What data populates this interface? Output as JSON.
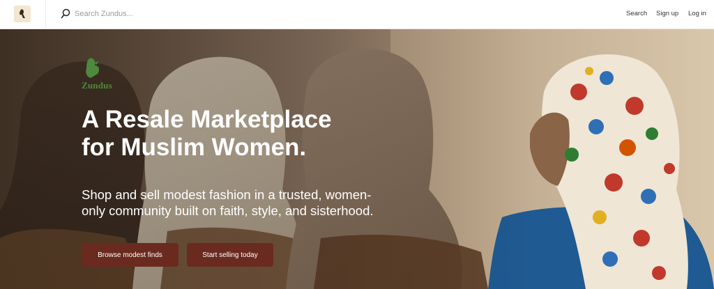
{
  "navbar": {
    "logo_icon": "bird-logo-icon",
    "search_placeholder": "Search Zundus...",
    "links": {
      "search": "Search",
      "signup": "Sign up",
      "login": "Log in"
    }
  },
  "hero": {
    "brand": "Zundus",
    "title_line1": "A Resale Marketplace",
    "title_line2": "for Muslim Women.",
    "subtitle_line1": "Shop and sell modest fashion in a trusted, women-",
    "subtitle_line2": "only community built on faith, style, and sisterhood.",
    "buttons": {
      "browse": "Browse modest finds",
      "sell": "Start selling today"
    }
  },
  "colors": {
    "button": "#6b2a1f",
    "brand_green": "#4e8a3e",
    "logo_bg": "#f1e6cf"
  }
}
